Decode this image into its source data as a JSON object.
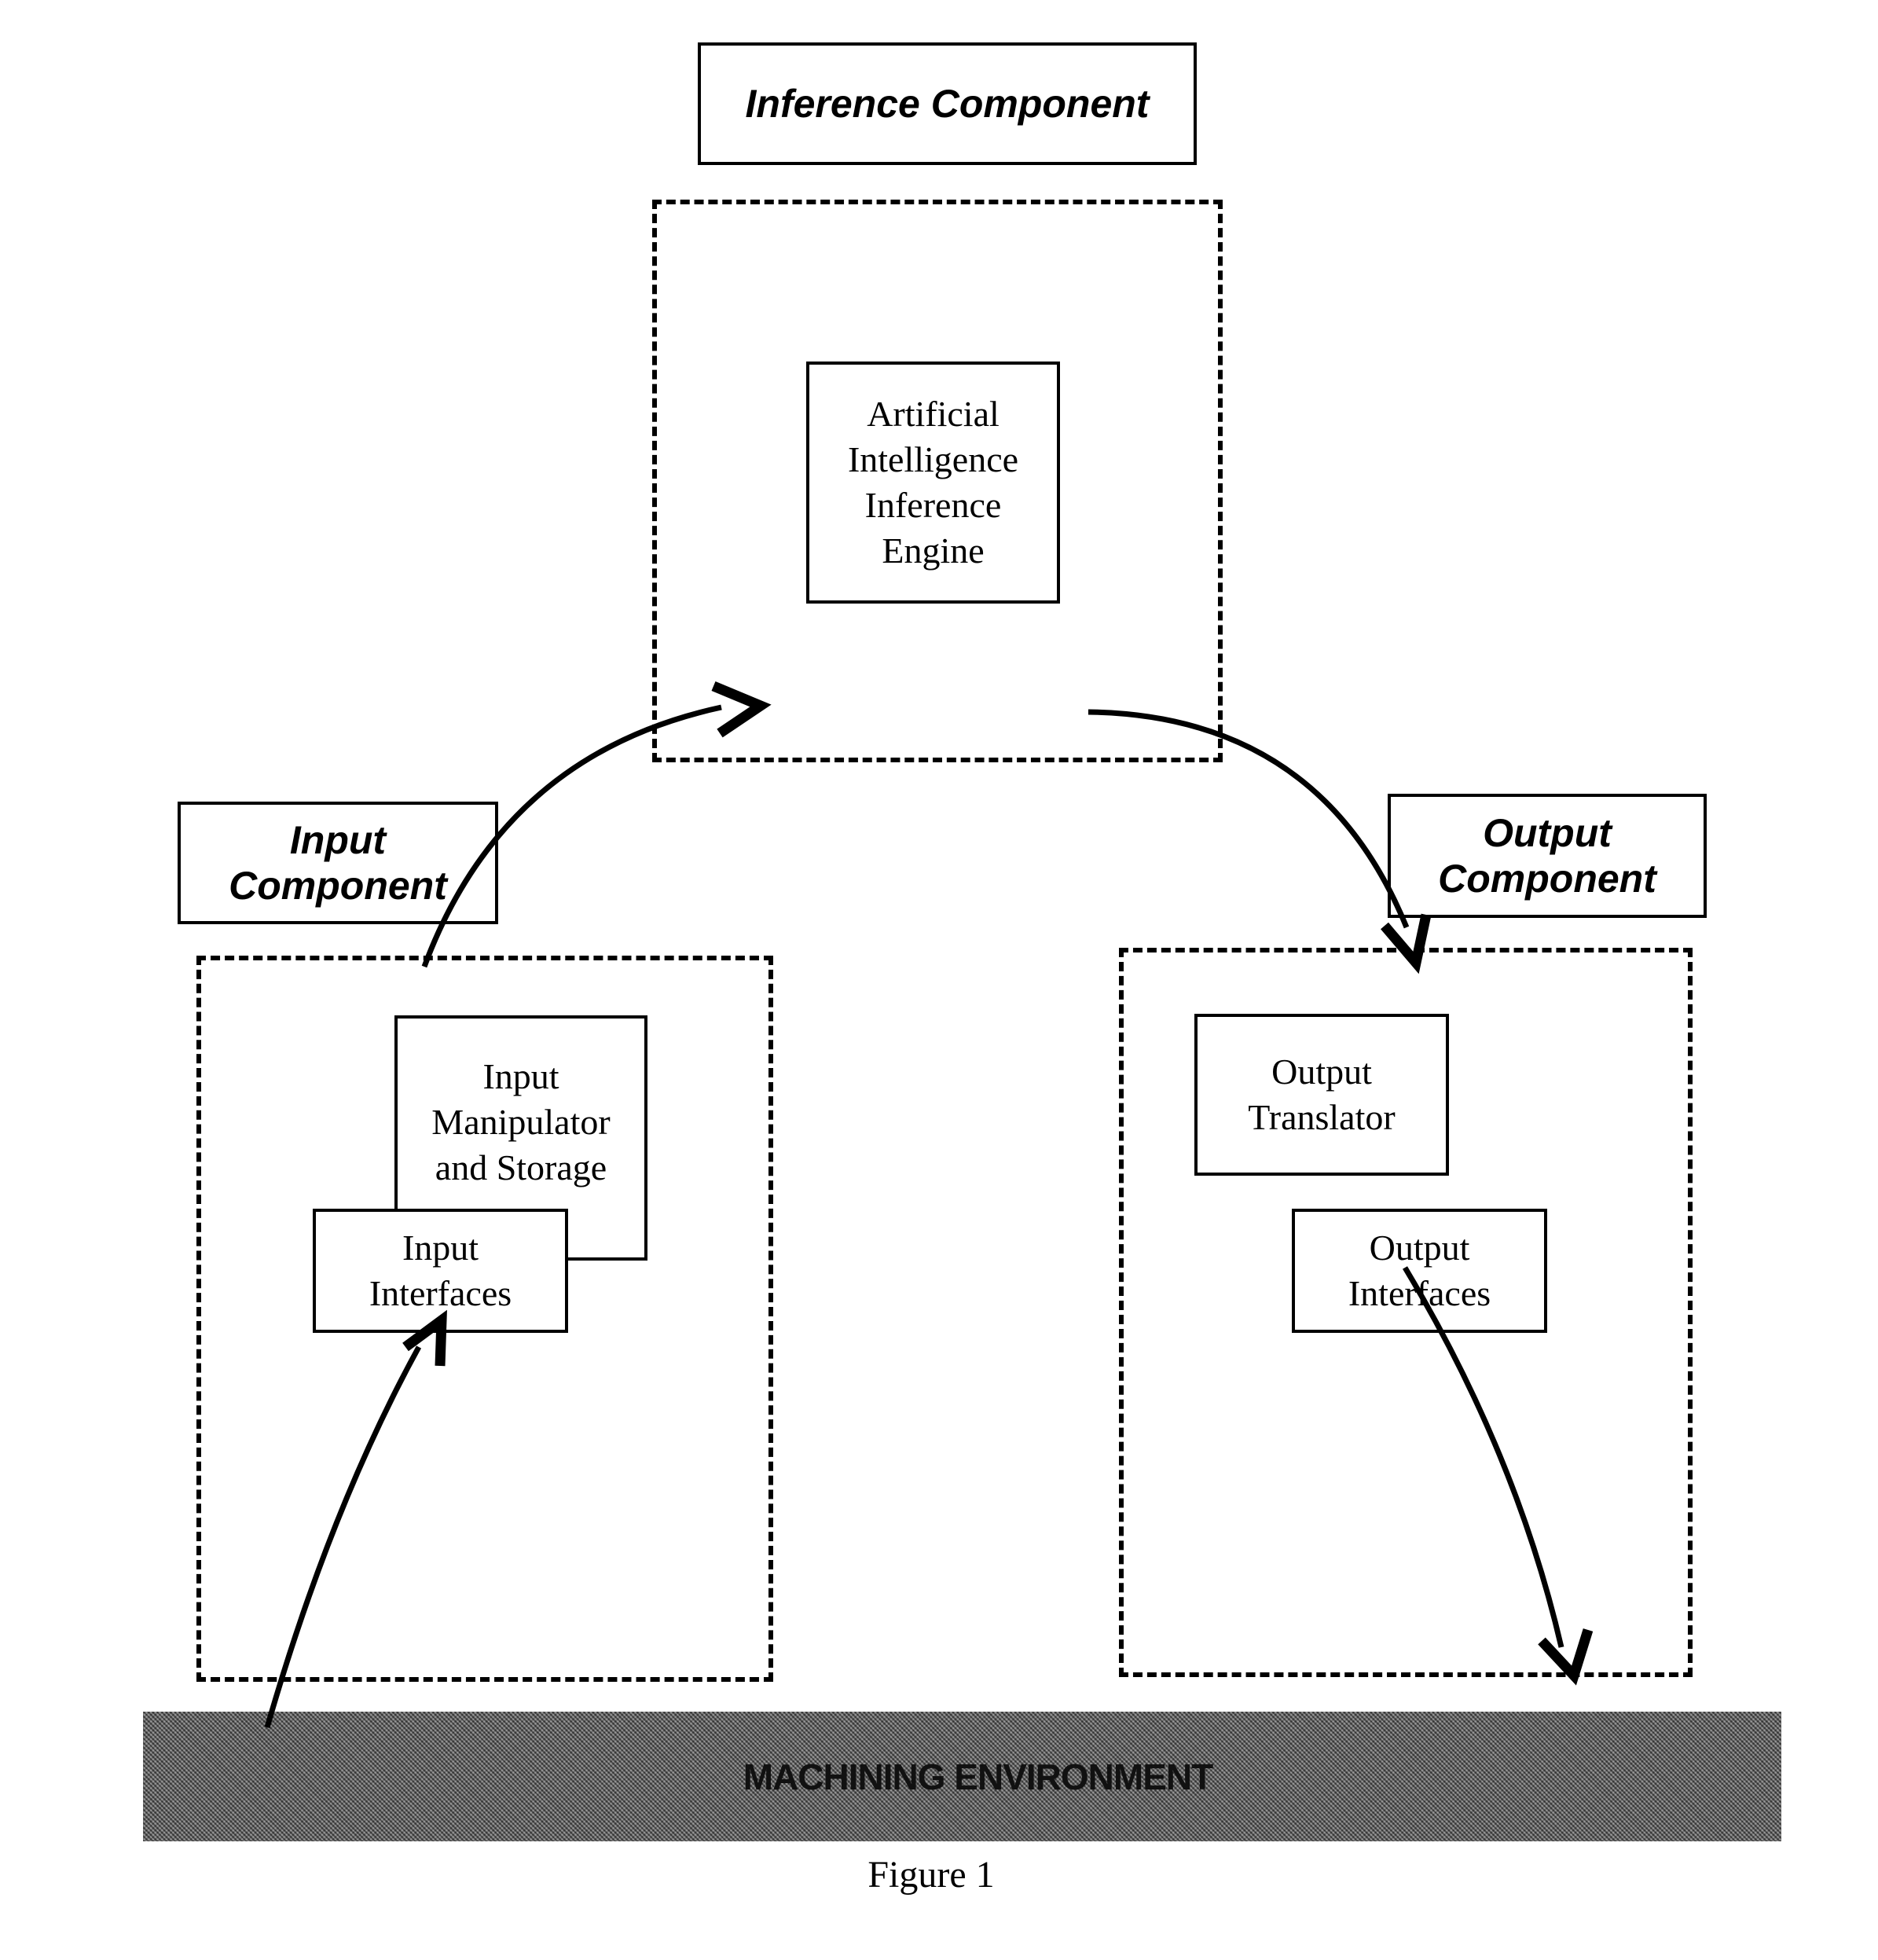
{
  "figure": {
    "caption": "Figure 1",
    "components": {
      "inference": {
        "title": "Inference Component",
        "blocks": [
          {
            "label": "Artificial\nIntelligence\nInference\nEngine"
          }
        ]
      },
      "input": {
        "title": "Input\nComponent",
        "blocks": [
          {
            "label": "Input\nManipulator\nand Storage"
          },
          {
            "label": "Input\nInterfaces"
          }
        ]
      },
      "output": {
        "title": "Output\nComponent",
        "blocks": [
          {
            "label": "Output\nTranslator"
          },
          {
            "label": "Output\nInterfaces"
          }
        ]
      }
    },
    "environment": {
      "label": "MACHINING ENVIRONMENT"
    },
    "flows": [
      {
        "from": "Machining Environment",
        "to": "Input Manipulator and Storage"
      },
      {
        "from": "Input Component",
        "to": "Inference Component"
      },
      {
        "from": "Inference Component",
        "to": "Output Component"
      },
      {
        "from": "Output Translator",
        "to": "Machining Environment"
      }
    ]
  }
}
